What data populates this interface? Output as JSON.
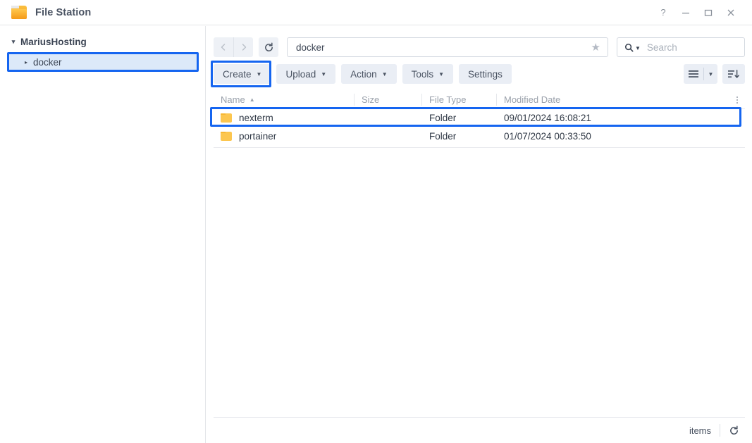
{
  "window": {
    "title": "File Station",
    "icon": "folder-icon",
    "controls": [
      {
        "name": "help-button",
        "glyph": "?"
      },
      {
        "name": "minimize-button",
        "glyph": "–"
      },
      {
        "name": "maximize-button",
        "glyph": "□"
      },
      {
        "name": "close-button",
        "glyph": "✕"
      }
    ]
  },
  "sidebar": {
    "root": {
      "label": "MariusHosting",
      "caret": "▾"
    },
    "children": [
      {
        "label": "docker",
        "caret": "▸",
        "selected": true
      }
    ]
  },
  "nav": {
    "back_icon": "chevron-left-icon",
    "forward_icon": "chevron-right-icon",
    "refresh_icon": "refresh-icon",
    "path_value": "docker",
    "path_placeholder": "",
    "favorite_icon": "star-icon",
    "search_placeholder": "Search",
    "search_value": "",
    "search_icon": "magnifier-icon"
  },
  "toolbar": {
    "buttons": [
      {
        "label": "Create",
        "dropdown": true,
        "highlighted": true
      },
      {
        "label": "Upload",
        "dropdown": true,
        "highlighted": false
      },
      {
        "label": "Action",
        "dropdown": true,
        "highlighted": false
      },
      {
        "label": "Tools",
        "dropdown": true,
        "highlighted": false
      },
      {
        "label": "Settings",
        "dropdown": false,
        "highlighted": false
      }
    ],
    "view_icon": "list-view-icon",
    "view_dropdown_icon": "chevron-down-icon",
    "sort_icon": "sort-descending-icon"
  },
  "filelist": {
    "columns": [
      {
        "label": "Name",
        "sorted": true,
        "sort_dir": "▲"
      },
      {
        "label": "Size",
        "sorted": false,
        "sort_dir": ""
      },
      {
        "label": "File Type",
        "sorted": false,
        "sort_dir": ""
      },
      {
        "label": "Modified Date",
        "sorted": false,
        "sort_dir": ""
      }
    ],
    "column_menu_icon": "kebab-menu-icon",
    "rows": [
      {
        "icon": "folder-icon",
        "name": "nexterm",
        "size": "",
        "type": "Folder",
        "modified": "09/01/2024 16:08:21",
        "highlighted": true
      },
      {
        "icon": "folder-icon",
        "name": "portainer",
        "size": "",
        "type": "Folder",
        "modified": "01/07/2024 00:33:50",
        "highlighted": false
      }
    ]
  },
  "statusbar": {
    "count": "",
    "items_label": "items",
    "refresh_icon": "refresh-icon"
  },
  "colors": {
    "annotation": "#1565f0",
    "selection_bg": "#dce9f9",
    "folder": "#fcc64f",
    "toolbar_btn": "#eaeef5",
    "text": "#3c4554"
  }
}
